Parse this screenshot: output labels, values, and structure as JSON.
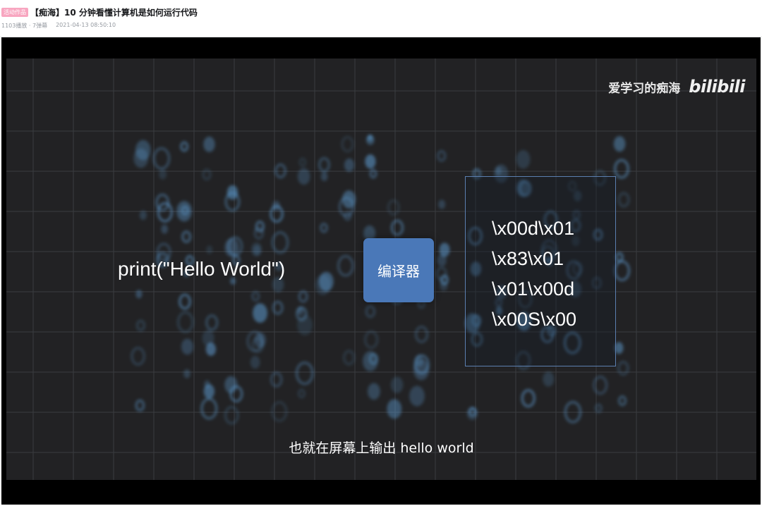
{
  "header": {
    "badge": "活动作品",
    "title": "【痴海】10 分钟看懂计算机是如何运行代码",
    "stats": "1103播放 · 7弹幕",
    "date": "2021-04-13 08:50:10"
  },
  "video": {
    "watermark_author": "爱学习的痴海",
    "watermark_logo": "bilibili",
    "code_text": "print(\"Hello World\")",
    "compiler_label": "编译器",
    "byte_lines": [
      "\\x00d\\x01",
      "\\x83\\x01",
      "\\x01\\x00d",
      "\\x00S\\x00"
    ],
    "subtitle": "也就在屏幕上输出 hello world"
  },
  "colors": {
    "badge_bg": "#f8a6c0",
    "compiler_bg": "#4a78b8",
    "frame_bg": "#222224",
    "rain_color": "#5f9fd6"
  }
}
